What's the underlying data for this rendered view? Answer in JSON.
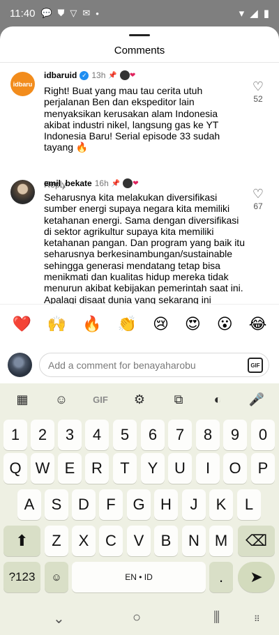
{
  "status": {
    "time": "11:40",
    "notif_icons": [
      "chat-bubble-icon",
      "shield-icon",
      "v-icon",
      "mail-icon",
      "dot-icon"
    ]
  },
  "sheet": {
    "title": "Comments"
  },
  "comments": [
    {
      "user": "idbaruid",
      "time": "13h",
      "text": "Right! Buat yang mau tau cerita utuh perjalanan Ben dan ekspeditor lain menyaksikan kerusakan alam Indonesia akibat industri nikel, langsung gas ke YT Indonesia Baru! Serial episode 33 sudah tayang 🔥",
      "reply": "Reply",
      "likes": "52",
      "avatar_text": "idbaru"
    },
    {
      "user": "emil_bekate",
      "time": "16h",
      "text": "Seharusnya kita melakukan diversifikasi sumber energi supaya negara kita memiliki ketahanan energi. Sama dengan diversifikasi di sektor agrikultur supaya kita memiliki ketahanan pangan. Dan program yang baik itu seharusnya berkesinambungan/sustainable sehingga generasi mendatang tetap bisa menikmati dan kualitas hidup mereka tidak menurun akibat kebijakan pemerintah saat ini. Apalagi disaat dunia yang sekarang ini semakin tak stabil. Keputusan pemimpin itu",
      "likes": "67"
    }
  ],
  "emojis": [
    "❤️",
    "🙌",
    "🔥",
    "👏",
    "😢",
    "😍",
    "😮",
    "😂"
  ],
  "compose": {
    "placeholder": "Add a comment for benayaharobu",
    "gif": "GIF"
  },
  "keyboard": {
    "toolbar": [
      "apps-icon",
      "sticker-icon",
      "GIF",
      "settings-icon",
      "translate-icon",
      "palette-icon",
      "mic-icon"
    ],
    "row1": [
      "1",
      "2",
      "3",
      "4",
      "5",
      "6",
      "7",
      "8",
      "9",
      "0"
    ],
    "row2": [
      "Q",
      "W",
      "E",
      "R",
      "T",
      "Y",
      "U",
      "I",
      "O",
      "P"
    ],
    "row3": [
      "A",
      "S",
      "D",
      "F",
      "G",
      "H",
      "J",
      "K",
      "L"
    ],
    "row4": [
      "Z",
      "X",
      "C",
      "V",
      "B",
      "N",
      "M"
    ],
    "symbols": "?123",
    "space": "EN • ID",
    "period": "."
  }
}
